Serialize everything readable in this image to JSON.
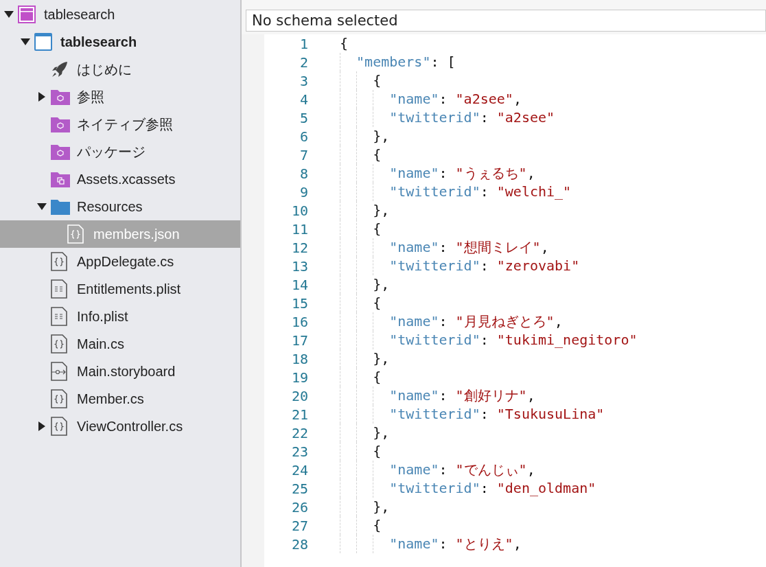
{
  "sidebar": {
    "tree": [
      {
        "label": "tablesearch",
        "kind": "solution",
        "expanded": true,
        "selected": false,
        "children": [
          {
            "label": "tablesearch",
            "kind": "project",
            "expanded": true,
            "selected": false,
            "bold": true,
            "children": [
              {
                "label": "はじめに",
                "kind": "getting-started",
                "selected": false
              },
              {
                "label": "参照",
                "kind": "reference-folder",
                "expanded": false,
                "selected": false
              },
              {
                "label": "ネイティブ参照",
                "kind": "reference-folder",
                "selected": false
              },
              {
                "label": "パッケージ",
                "kind": "reference-folder",
                "selected": false
              },
              {
                "label": "Assets.xcassets",
                "kind": "asset-catalog",
                "selected": false
              },
              {
                "label": "Resources",
                "kind": "folder",
                "expanded": true,
                "selected": false,
                "children": [
                  {
                    "label": "members.json",
                    "kind": "code-file",
                    "selected": true
                  }
                ]
              },
              {
                "label": "AppDelegate.cs",
                "kind": "code-file",
                "selected": false
              },
              {
                "label": "Entitlements.plist",
                "kind": "plist-file",
                "selected": false
              },
              {
                "label": "Info.plist",
                "kind": "plist-file",
                "selected": false
              },
              {
                "label": "Main.cs",
                "kind": "code-file",
                "selected": false
              },
              {
                "label": "Main.storyboard",
                "kind": "storyboard-file",
                "selected": false
              },
              {
                "label": "Member.cs",
                "kind": "code-file",
                "selected": false
              },
              {
                "label": "ViewController.cs",
                "kind": "code-file",
                "expanded": false,
                "selected": false
              }
            ]
          }
        ]
      }
    ]
  },
  "editor": {
    "schema": {
      "value": "No schema selected"
    },
    "lines": [
      {
        "number": "1",
        "tokens": [
          {
            "kind": "punct",
            "text": "{"
          }
        ],
        "children": [
          {
            "number": "2",
            "tokens": [
              {
                "kind": "key",
                "text": "\"members\""
              },
              {
                "kind": "punct",
                "text": ": ["
              }
            ],
            "children": [
              {
                "number": "3",
                "tokens": [
                  {
                    "kind": "punct",
                    "text": "{"
                  }
                ],
                "children": [
                  {
                    "number": "4",
                    "tokens": [
                      {
                        "kind": "key",
                        "text": "\"name\""
                      },
                      {
                        "kind": "punct",
                        "text": ": "
                      },
                      {
                        "kind": "string",
                        "text": "\"a2see\""
                      },
                      {
                        "kind": "punct",
                        "text": ","
                      }
                    ]
                  },
                  {
                    "number": "5",
                    "tokens": [
                      {
                        "kind": "key",
                        "text": "\"twitterid\""
                      },
                      {
                        "kind": "punct",
                        "text": ": "
                      },
                      {
                        "kind": "string",
                        "text": "\"a2see\""
                      }
                    ]
                  }
                ]
              },
              {
                "number": "6",
                "tokens": [
                  {
                    "kind": "punct",
                    "text": "},"
                  }
                ]
              },
              {
                "number": "7",
                "tokens": [
                  {
                    "kind": "punct",
                    "text": "{"
                  }
                ],
                "children": [
                  {
                    "number": "8",
                    "tokens": [
                      {
                        "kind": "key",
                        "text": "\"name\""
                      },
                      {
                        "kind": "punct",
                        "text": ": "
                      },
                      {
                        "kind": "string",
                        "text": "\"うぇるち\""
                      },
                      {
                        "kind": "punct",
                        "text": ","
                      }
                    ]
                  },
                  {
                    "number": "9",
                    "tokens": [
                      {
                        "kind": "key",
                        "text": "\"twitterid\""
                      },
                      {
                        "kind": "punct",
                        "text": ": "
                      },
                      {
                        "kind": "string",
                        "text": "\"welchi_\""
                      }
                    ]
                  }
                ]
              },
              {
                "number": "10",
                "tokens": [
                  {
                    "kind": "punct",
                    "text": "},"
                  }
                ]
              },
              {
                "number": "11",
                "tokens": [
                  {
                    "kind": "punct",
                    "text": "{"
                  }
                ],
                "children": [
                  {
                    "number": "12",
                    "tokens": [
                      {
                        "kind": "key",
                        "text": "\"name\""
                      },
                      {
                        "kind": "punct",
                        "text": ": "
                      },
                      {
                        "kind": "string",
                        "text": "\"想間ミレイ\""
                      },
                      {
                        "kind": "punct",
                        "text": ","
                      }
                    ]
                  },
                  {
                    "number": "13",
                    "tokens": [
                      {
                        "kind": "key",
                        "text": "\"twitterid\""
                      },
                      {
                        "kind": "punct",
                        "text": ": "
                      },
                      {
                        "kind": "string",
                        "text": "\"zerovabi\""
                      }
                    ]
                  }
                ]
              },
              {
                "number": "14",
                "tokens": [
                  {
                    "kind": "punct",
                    "text": "},"
                  }
                ]
              },
              {
                "number": "15",
                "tokens": [
                  {
                    "kind": "punct",
                    "text": "{"
                  }
                ],
                "children": [
                  {
                    "number": "16",
                    "tokens": [
                      {
                        "kind": "key",
                        "text": "\"name\""
                      },
                      {
                        "kind": "punct",
                        "text": ": "
                      },
                      {
                        "kind": "string",
                        "text": "\"月見ねぎとろ\""
                      },
                      {
                        "kind": "punct",
                        "text": ","
                      }
                    ]
                  },
                  {
                    "number": "17",
                    "tokens": [
                      {
                        "kind": "key",
                        "text": "\"twitterid\""
                      },
                      {
                        "kind": "punct",
                        "text": ": "
                      },
                      {
                        "kind": "string",
                        "text": "\"tukimi_negitoro\""
                      }
                    ]
                  }
                ]
              },
              {
                "number": "18",
                "tokens": [
                  {
                    "kind": "punct",
                    "text": "},"
                  }
                ]
              },
              {
                "number": "19",
                "tokens": [
                  {
                    "kind": "punct",
                    "text": "{"
                  }
                ],
                "children": [
                  {
                    "number": "20",
                    "tokens": [
                      {
                        "kind": "key",
                        "text": "\"name\""
                      },
                      {
                        "kind": "punct",
                        "text": ": "
                      },
                      {
                        "kind": "string",
                        "text": "\"創好リナ\""
                      },
                      {
                        "kind": "punct",
                        "text": ","
                      }
                    ]
                  },
                  {
                    "number": "21",
                    "tokens": [
                      {
                        "kind": "key",
                        "text": "\"twitterid\""
                      },
                      {
                        "kind": "punct",
                        "text": ": "
                      },
                      {
                        "kind": "string",
                        "text": "\"TsukusuLina\""
                      }
                    ]
                  }
                ]
              },
              {
                "number": "22",
                "tokens": [
                  {
                    "kind": "punct",
                    "text": "},"
                  }
                ]
              },
              {
                "number": "23",
                "tokens": [
                  {
                    "kind": "punct",
                    "text": "{"
                  }
                ],
                "children": [
                  {
                    "number": "24",
                    "tokens": [
                      {
                        "kind": "key",
                        "text": "\"name\""
                      },
                      {
                        "kind": "punct",
                        "text": ": "
                      },
                      {
                        "kind": "string",
                        "text": "\"でんじぃ\""
                      },
                      {
                        "kind": "punct",
                        "text": ","
                      }
                    ]
                  },
                  {
                    "number": "25",
                    "tokens": [
                      {
                        "kind": "key",
                        "text": "\"twitterid\""
                      },
                      {
                        "kind": "punct",
                        "text": ": "
                      },
                      {
                        "kind": "string",
                        "text": "\"den_oldman\""
                      }
                    ]
                  }
                ]
              },
              {
                "number": "26",
                "tokens": [
                  {
                    "kind": "punct",
                    "text": "},"
                  }
                ]
              },
              {
                "number": "27",
                "tokens": [
                  {
                    "kind": "punct",
                    "text": "{"
                  }
                ],
                "children": [
                  {
                    "number": "28",
                    "tokens": [
                      {
                        "kind": "key",
                        "text": "\"name\""
                      },
                      {
                        "kind": "punct",
                        "text": ": "
                      },
                      {
                        "kind": "string",
                        "text": "\"とりえ\""
                      },
                      {
                        "kind": "punct",
                        "text": ","
                      }
                    ]
                  }
                ]
              }
            ]
          }
        ]
      }
    ]
  }
}
